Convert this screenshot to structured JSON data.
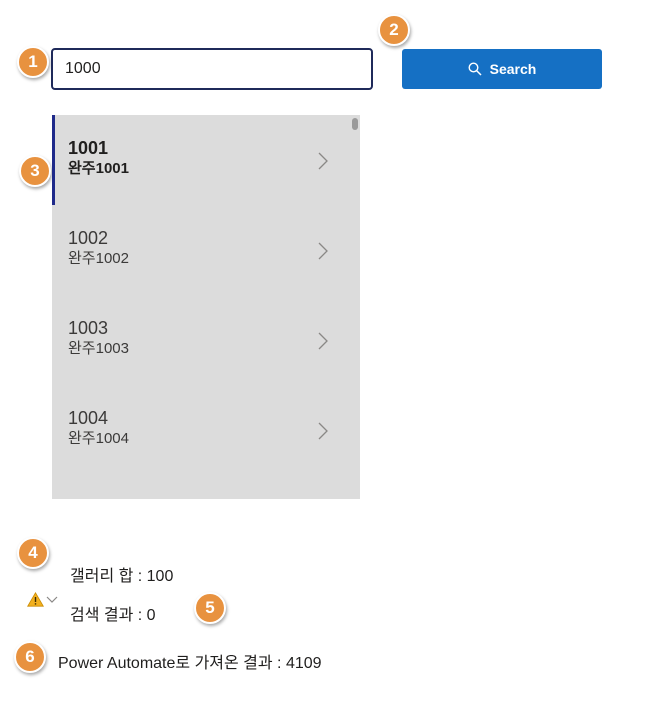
{
  "badges": [
    "1",
    "2",
    "3",
    "4",
    "5",
    "6"
  ],
  "search": {
    "value": "1000",
    "button_label": "Search"
  },
  "gallery": {
    "items": [
      {
        "title": "1001",
        "subtitle": "완주1001"
      },
      {
        "title": "1002",
        "subtitle": "완주1002"
      },
      {
        "title": "1003",
        "subtitle": "완주1003"
      },
      {
        "title": "1004",
        "subtitle": "완주1004"
      }
    ],
    "selected_index": 0
  },
  "labels": {
    "gallery_sum": "갤러리 합 : 100",
    "search_result": "검색 결과 : 0",
    "pa_result": "Power Automate로 가져온 결과 :  4109"
  },
  "colors": {
    "accent": "#1570c4",
    "badge": "#e8923f",
    "gallery_bg": "#dcdcdc",
    "selection_bar": "#1f2a8a",
    "warning": "#f2b01e"
  }
}
